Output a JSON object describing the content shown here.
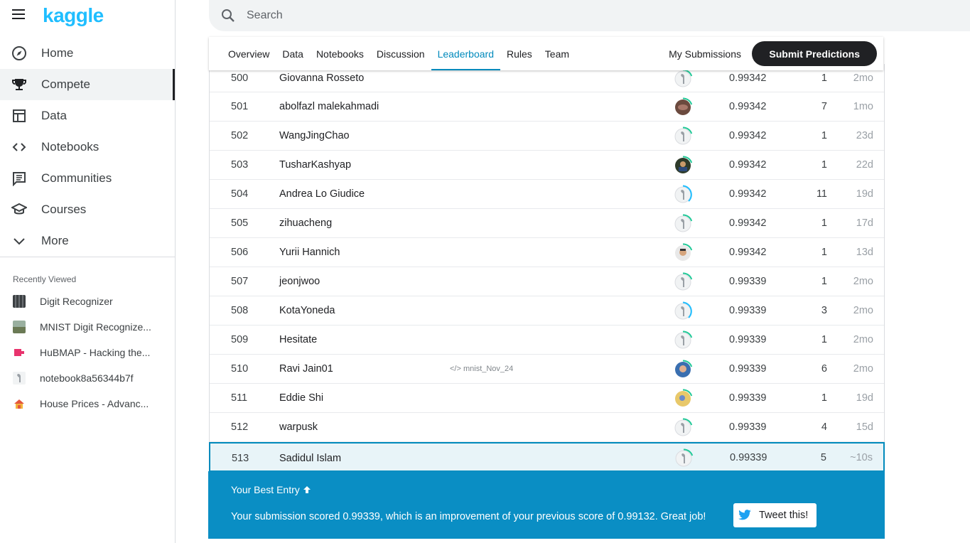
{
  "brand": {
    "logo": "kaggle"
  },
  "search": {
    "placeholder": "Search"
  },
  "nav": [
    {
      "label": "Home",
      "icon": "compass-icon"
    },
    {
      "label": "Compete",
      "icon": "trophy-icon",
      "active": true
    },
    {
      "label": "Data",
      "icon": "table-icon"
    },
    {
      "label": "Notebooks",
      "icon": "code-icon"
    },
    {
      "label": "Communities",
      "icon": "comments-icon"
    },
    {
      "label": "Courses",
      "icon": "graduation-cap-icon"
    },
    {
      "label": "More",
      "icon": "chevron-down-icon"
    }
  ],
  "recent": {
    "title": "Recently Viewed",
    "items": [
      {
        "label": "Digit Recognizer",
        "color": "#3c4043"
      },
      {
        "label": "MNIST Digit Recognize...",
        "color": "#7a8a6a"
      },
      {
        "label": "HuBMAP - Hacking the...",
        "color": "#e8336d"
      },
      {
        "label": "notebook8a56344b7f",
        "color": "#c8c8c8"
      },
      {
        "label": "House Prices - Advanc...",
        "color": "#e4573d"
      }
    ]
  },
  "tabs": [
    "Overview",
    "Data",
    "Notebooks",
    "Discussion",
    "Leaderboard",
    "Rules",
    "Team"
  ],
  "active_tab": "Leaderboard",
  "actions": {
    "my_submissions": "My Submissions",
    "submit": "Submit Predictions"
  },
  "leaderboard": [
    {
      "rank": "500",
      "name": "Giovanna Rosseto",
      "notebook": "",
      "score": "0.99342",
      "entries": "1",
      "last": "2mo",
      "avatar": "default"
    },
    {
      "rank": "501",
      "name": "abolfazl malekahmadi",
      "notebook": "",
      "score": "0.99342",
      "entries": "7",
      "last": "1mo",
      "avatar": "photo-brown"
    },
    {
      "rank": "502",
      "name": "WangJingChao",
      "notebook": "",
      "score": "0.99342",
      "entries": "1",
      "last": "23d",
      "avatar": "default"
    },
    {
      "rank": "503",
      "name": "TusharKashyap",
      "notebook": "",
      "score": "0.99342",
      "entries": "1",
      "last": "22d",
      "avatar": "photo-dark"
    },
    {
      "rank": "504",
      "name": "Andrea Lo Giudice",
      "notebook": "",
      "score": "0.99342",
      "entries": "11",
      "last": "19d",
      "avatar": "default-blue"
    },
    {
      "rank": "505",
      "name": "zihuacheng",
      "notebook": "",
      "score": "0.99342",
      "entries": "1",
      "last": "17d",
      "avatar": "default"
    },
    {
      "rank": "506",
      "name": "Yurii Hannich",
      "notebook": "",
      "score": "0.99342",
      "entries": "1",
      "last": "13d",
      "avatar": "photo-face"
    },
    {
      "rank": "507",
      "name": "jeonjwoo",
      "notebook": "",
      "score": "0.99339",
      "entries": "1",
      "last": "2mo",
      "avatar": "default"
    },
    {
      "rank": "508",
      "name": "KotaYoneda",
      "notebook": "",
      "score": "0.99339",
      "entries": "3",
      "last": "2mo",
      "avatar": "default-blue"
    },
    {
      "rank": "509",
      "name": "Hesitate",
      "notebook": "",
      "score": "0.99339",
      "entries": "1",
      "last": "2mo",
      "avatar": "default"
    },
    {
      "rank": "510",
      "name": "Ravi Jain01",
      "notebook": "mnist_Nov_24",
      "score": "0.99339",
      "entries": "6",
      "last": "2mo",
      "avatar": "photo-blue"
    },
    {
      "rank": "511",
      "name": "Eddie Shi",
      "notebook": "",
      "score": "0.99339",
      "entries": "1",
      "last": "19d",
      "avatar": "photo-yellow"
    },
    {
      "rank": "512",
      "name": "warpusk",
      "notebook": "",
      "score": "0.99339",
      "entries": "4",
      "last": "15d",
      "avatar": "default"
    },
    {
      "rank": "513",
      "name": "Sadidul Islam",
      "notebook": "",
      "score": "0.99339",
      "entries": "5",
      "last": "~10s",
      "avatar": "default",
      "mine": true
    }
  ],
  "banner": {
    "title": "Your Best Entry",
    "message": "Your submission scored 0.99339, which is an improvement of your previous score of 0.99132. Great job!",
    "tweet": "Tweet this!"
  }
}
